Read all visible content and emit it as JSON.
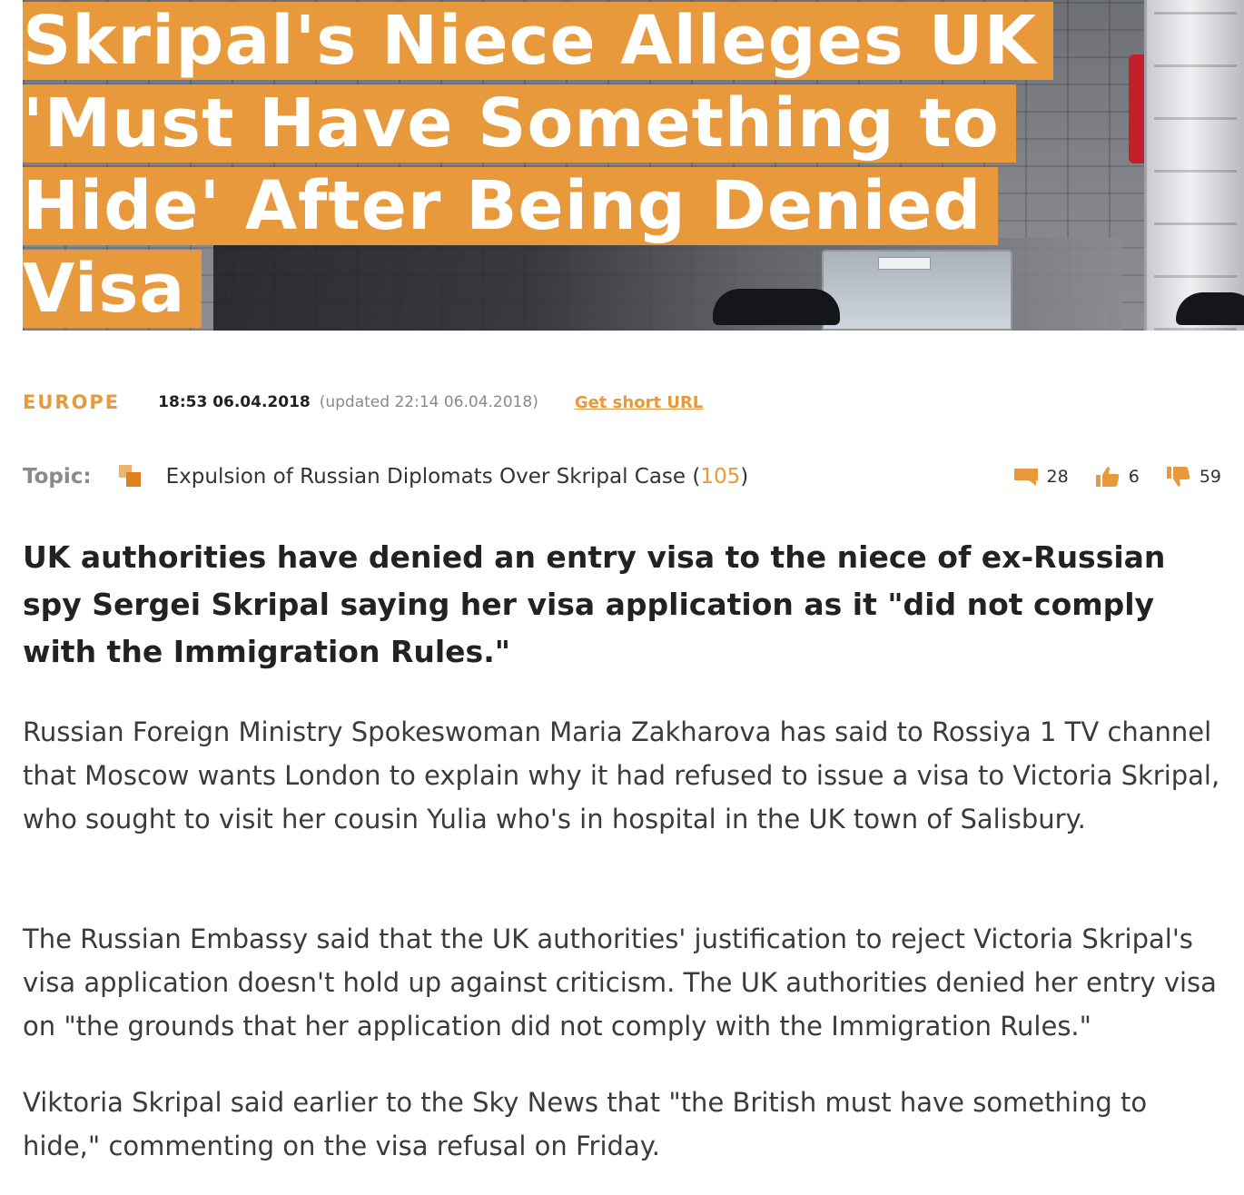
{
  "article": {
    "headline": "Skripal's Niece Alleges UK 'Must Have Something to Hide' After Being Denied Visa",
    "section": "EUROPE",
    "published": "18:53 06.04.2018",
    "updated": "(updated 22:14 06.04.2018)",
    "short_url_label": "Get short URL",
    "topic_label": "Topic:",
    "topic_title": "Expulsion of Russian Diplomats Over Skripal Case",
    "topic_count_open": "(",
    "topic_count": "105",
    "topic_count_close": ")",
    "lede": "UK authorities have denied an entry visa to the niece of ex-Russian spy Sergei Skripal saying her visa application as it \"did not comply with the Immigration Rules.\"",
    "paragraphs": [
      "Russian Foreign Ministry Spokeswoman Maria Zakharova has said to Rossiya 1 TV channel that Moscow wants London to explain why it had refused to issue a visa to Victoria Skripal, who sought to visit her cousin Yulia who's in hospital in the UK town of Salisbury.",
      "The Russian Embassy said that the UK authorities' justification to reject Victoria Skripal's visa application doesn't hold up against criticism. The UK authorities denied her entry visa on \"the grounds that her application did not comply with the Immigration Rules.\"",
      "Viktoria Skripal said earlier to the Sky News that \"the British must have something to hide,\" commenting on the visa refusal on Friday."
    ]
  },
  "stats": {
    "comments": "28",
    "likes": "6",
    "dislikes": "59"
  },
  "icons": {
    "topic": "topic-stack-icon",
    "comments": "comment-icon",
    "likes": "thumbs-up-icon",
    "dislikes": "thumbs-down-icon"
  },
  "colors": {
    "accent": "#e8993b",
    "text": "#333333",
    "muted": "#8a8a8a"
  }
}
